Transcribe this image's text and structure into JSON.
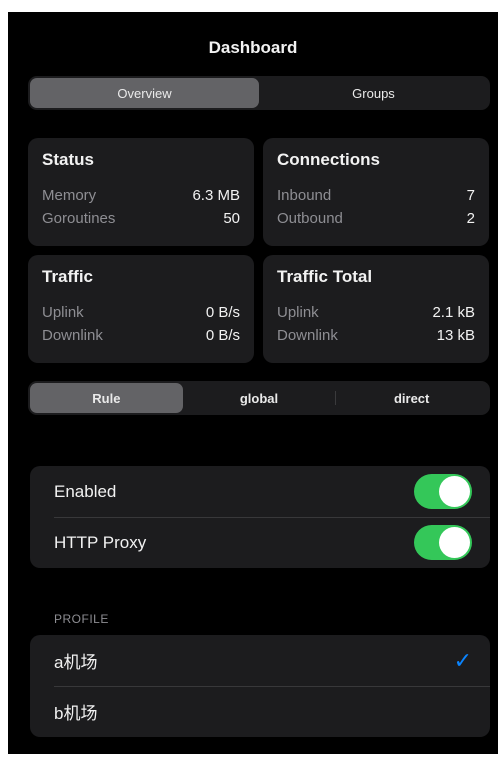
{
  "header": {
    "title": "Dashboard"
  },
  "top_tabs": [
    {
      "label": "Overview",
      "selected": true
    },
    {
      "label": "Groups",
      "selected": false
    }
  ],
  "cards": {
    "status": {
      "title": "Status",
      "rows": [
        {
          "k": "Memory",
          "v": "6.3 MB"
        },
        {
          "k": "Goroutines",
          "v": "50"
        }
      ]
    },
    "connections": {
      "title": "Connections",
      "rows": [
        {
          "k": "Inbound",
          "v": "7"
        },
        {
          "k": "Outbound",
          "v": "2"
        }
      ]
    },
    "traffic": {
      "title": "Traffic",
      "rows": [
        {
          "k": "Uplink",
          "v": "0 B/s"
        },
        {
          "k": "Downlink",
          "v": "0 B/s"
        }
      ]
    },
    "traffic_total": {
      "title": "Traffic Total",
      "rows": [
        {
          "k": "Uplink",
          "v": "2.1 kB"
        },
        {
          "k": "Downlink",
          "v": "13 kB"
        }
      ]
    }
  },
  "mode_tabs": [
    {
      "label": "Rule",
      "selected": true
    },
    {
      "label": "global",
      "selected": false
    },
    {
      "label": "direct",
      "selected": false
    }
  ],
  "settings": [
    {
      "label": "Enabled",
      "on": true
    },
    {
      "label": "HTTP Proxy",
      "on": true
    }
  ],
  "profile": {
    "section_label": "PROFILE",
    "items": [
      {
        "label": "a机场",
        "checked": true,
        "check_glyph": "✓"
      },
      {
        "label": "b机场",
        "checked": false
      }
    ]
  },
  "colors": {
    "accent_toggle": "#34c759",
    "check": "#0a84ff"
  },
  "icons": {
    "check": "checkmark-icon"
  }
}
